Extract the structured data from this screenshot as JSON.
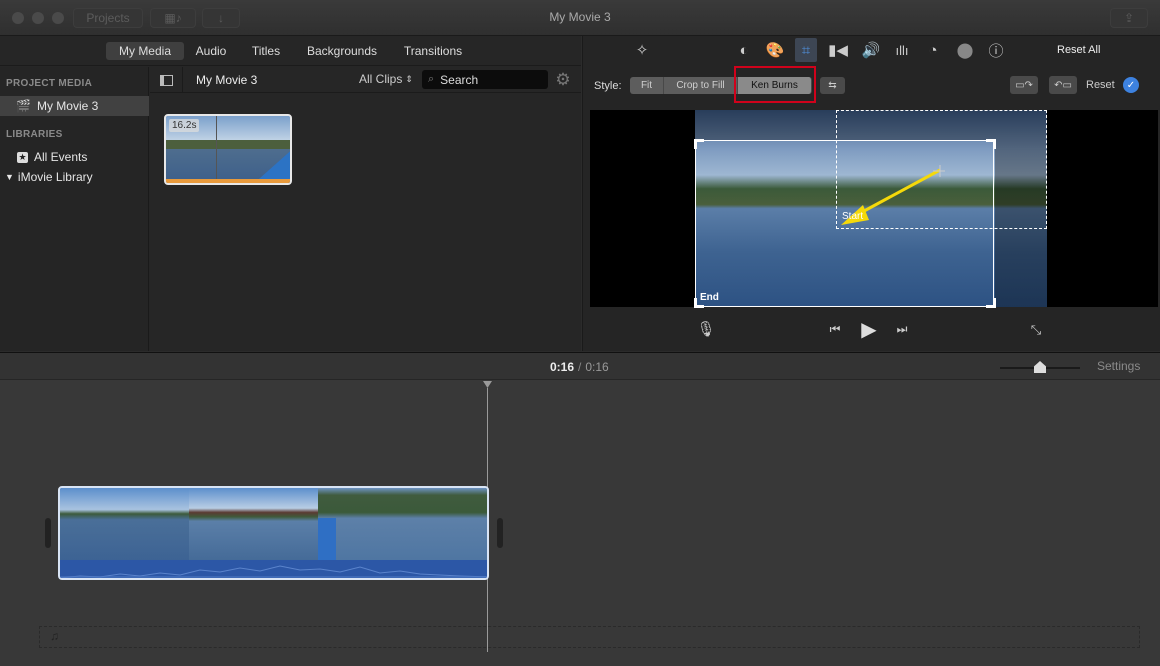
{
  "window": {
    "title": "My Movie 3",
    "projects_label": "Projects"
  },
  "media_tabs": [
    {
      "label": "My Media",
      "active": true
    },
    {
      "label": "Audio",
      "active": false
    },
    {
      "label": "Titles",
      "active": false
    },
    {
      "label": "Backgrounds",
      "active": false
    },
    {
      "label": "Transitions",
      "active": false
    }
  ],
  "sidebar": {
    "project_media_header": "PROJECT MEDIA",
    "project_item": "My Movie 3",
    "libraries_header": "LIBRARIES",
    "all_events": "All Events",
    "library": "iMovie Library"
  },
  "browser": {
    "title": "My Movie 3",
    "filter": "All Clips",
    "search_placeholder": "Search",
    "clips": [
      {
        "duration": "16.2s"
      }
    ]
  },
  "inspector": {
    "reset_all": "Reset All",
    "style_label": "Style:",
    "styles": [
      {
        "label": "Fit",
        "selected": false
      },
      {
        "label": "Crop to Fill",
        "selected": false
      },
      {
        "label": "Ken Burns",
        "selected": true
      }
    ],
    "reset_label": "Reset",
    "highlight_color": "#d0021b"
  },
  "viewer": {
    "start_label": "Start",
    "end_label": "End"
  },
  "timeline": {
    "current_time": "0:16",
    "separator": "/",
    "total_time": "0:16",
    "settings_label": "Settings",
    "zoom_level": 0.5
  }
}
